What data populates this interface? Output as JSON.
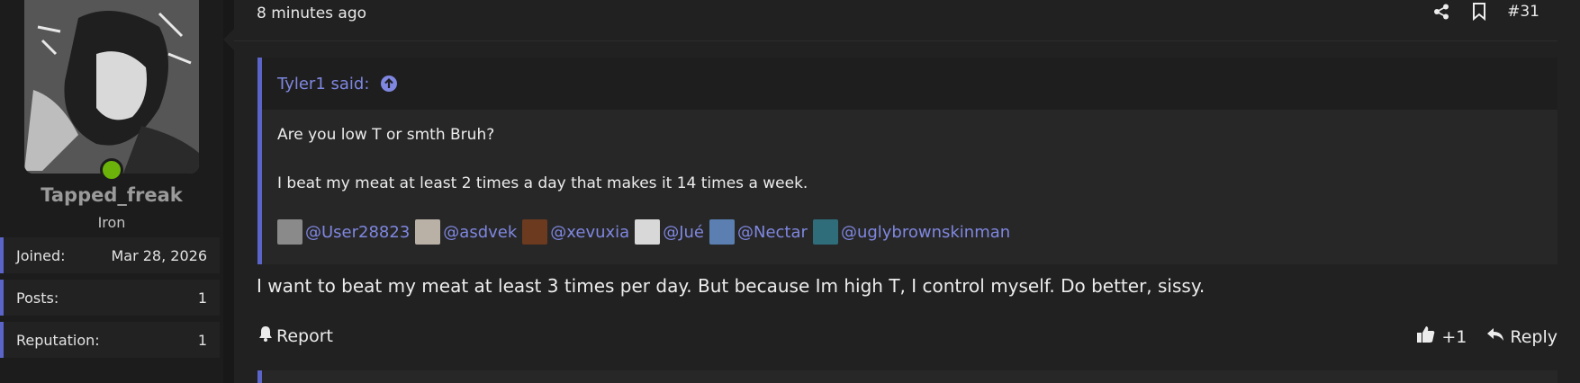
{
  "user": {
    "username": "Tapped_freak",
    "rank": "Iron",
    "status": "online",
    "stats": [
      {
        "label": "Joined:",
        "value": "Mar 28, 2026"
      },
      {
        "label": "Posts:",
        "value": "1"
      },
      {
        "label": "Reputation:",
        "value": "1"
      }
    ]
  },
  "post": {
    "time": "8 minutes ago",
    "number": "#31",
    "actions": [
      "share-icon",
      "bookmark-icon"
    ],
    "quote": {
      "author_label": "Tyler1 said:",
      "lines": [
        "Are you low T or smth Bruh?",
        "I beat my meat at least 2 times a day that makes it 14 times a week."
      ],
      "mentions": [
        {
          "name": "@User28823",
          "color": "#8a8a8a"
        },
        {
          "name": "@asdvek",
          "color": "#b9b0a6"
        },
        {
          "name": "@xevuxia",
          "color": "#6b3a1f"
        },
        {
          "name": "@Jué",
          "color": "#d8d8d8"
        },
        {
          "name": "@Nectar",
          "color": "#5a7fb0"
        },
        {
          "name": "@uglybrownskinman",
          "color": "#2f6d7a"
        }
      ]
    },
    "body": "I want to beat my meat at least 3 times per day. But because Im high T, I control myself. Do better, sissy.",
    "footer": {
      "report_label": "Report",
      "like_count": "+1",
      "reply_label": "Reply"
    }
  },
  "colors": {
    "accent": "#5b64c8",
    "link": "#7f87e0",
    "online": "#6bb30a"
  }
}
